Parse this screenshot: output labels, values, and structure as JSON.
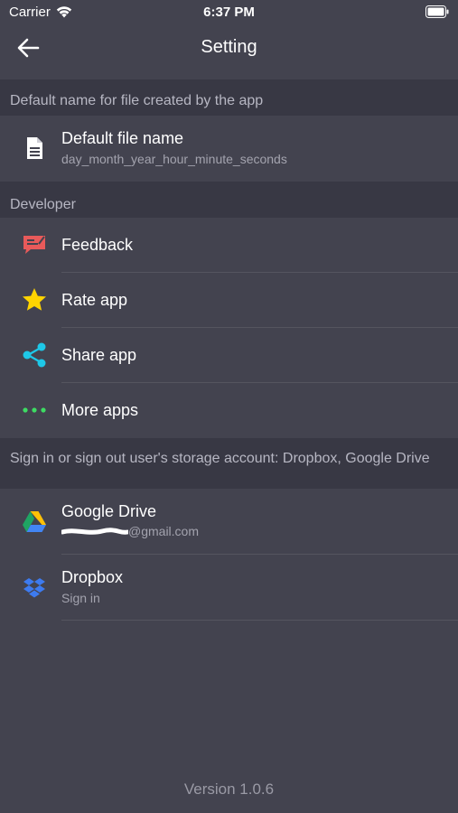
{
  "status_bar": {
    "carrier": "Carrier",
    "time": "6:37 PM"
  },
  "nav": {
    "title": "Setting",
    "back_icon": "arrow-left-icon"
  },
  "sections": {
    "file": {
      "header": "Default name for file created by the app",
      "rows": [
        {
          "title": "Default file name",
          "subtitle": "day_month_year_hour_minute_seconds",
          "icon": "document-icon"
        }
      ]
    },
    "developer": {
      "header": "Developer",
      "rows": [
        {
          "title": "Feedback",
          "icon": "feedback-icon"
        },
        {
          "title": "Rate app",
          "icon": "star-icon"
        },
        {
          "title": "Share app",
          "icon": "share-icon"
        },
        {
          "title": "More apps",
          "icon": "more-dots-icon"
        }
      ]
    },
    "storage": {
      "header": "Sign in or sign out user's storage account: Dropbox, Google Drive",
      "rows": [
        {
          "title": "Google Drive",
          "subtitle": "@gmail.com",
          "icon": "google-drive-icon"
        },
        {
          "title": "Dropbox",
          "subtitle": "Sign in",
          "icon": "dropbox-icon"
        }
      ]
    }
  },
  "version": "Version 1.0.6",
  "colors": {
    "background": "#43434f",
    "section_header_bg": "#383844",
    "feedback": "#e85a5a",
    "star": "#ffd400",
    "share": "#1ec8e8",
    "more": "#3ddc63",
    "dropbox": "#3d7bf0"
  }
}
